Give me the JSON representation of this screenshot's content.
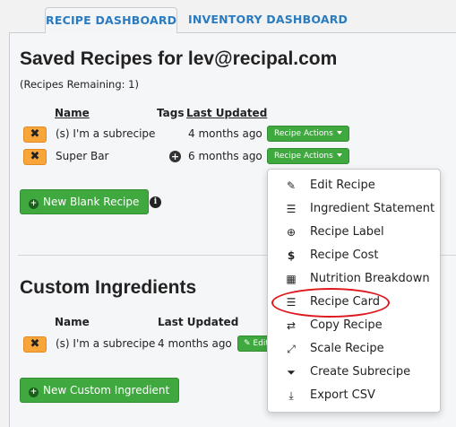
{
  "tabs": [
    {
      "label": "RECIPE DASHBOARD",
      "active": true
    },
    {
      "label": "INVENTORY DASHBOARD",
      "active": false
    }
  ],
  "saved": {
    "title": "Saved Recipes for lev@recipal.com",
    "remaining": "(Recipes Remaining: 1)",
    "headers": {
      "name": "Name",
      "tags": "Tags",
      "updated": "Last Updated"
    },
    "rows": [
      {
        "delete": "✖",
        "name": "(s) I'm a subrecipe",
        "updated": "4 months ago",
        "actions": "Recipe Actions"
      },
      {
        "delete": "✖",
        "name": "Super Bar",
        "updated": "6 months ago",
        "actions": "Recipe Actions"
      }
    ],
    "new_button": "New Blank Recipe"
  },
  "custom": {
    "title": "Custom Ingredients",
    "headers": {
      "name": "Name",
      "updated": "Last Updated"
    },
    "rows": [
      {
        "delete": "✖",
        "name": "(s) I'm a subrecipe",
        "updated": "4 months ago",
        "edit": "Edit"
      }
    ],
    "new_button": "New Custom Ingredient"
  },
  "menu": {
    "items": [
      {
        "label": "Edit Recipe",
        "icon": "pencil-icon"
      },
      {
        "label": "Ingredient Statement",
        "icon": "list-icon"
      },
      {
        "label": "Recipe Label",
        "icon": "search-plus-icon"
      },
      {
        "label": "Recipe Cost",
        "icon": "dollar-icon"
      },
      {
        "label": "Nutrition Breakdown",
        "icon": "grid-icon"
      },
      {
        "label": "Recipe Card",
        "icon": "list-icon"
      },
      {
        "label": "Copy Recipe",
        "icon": "retweet-icon"
      },
      {
        "label": "Scale Recipe",
        "icon": "expand-icon"
      },
      {
        "label": "Create Subrecipe",
        "icon": "filter-icon"
      },
      {
        "label": "Export CSV",
        "icon": "download-icon"
      }
    ],
    "highlighted": "Recipe Card"
  },
  "colors": {
    "accent": "#2a7bbf",
    "green": "#3fa83f",
    "orange": "#f8a53a",
    "highlight": "#e0161d"
  }
}
